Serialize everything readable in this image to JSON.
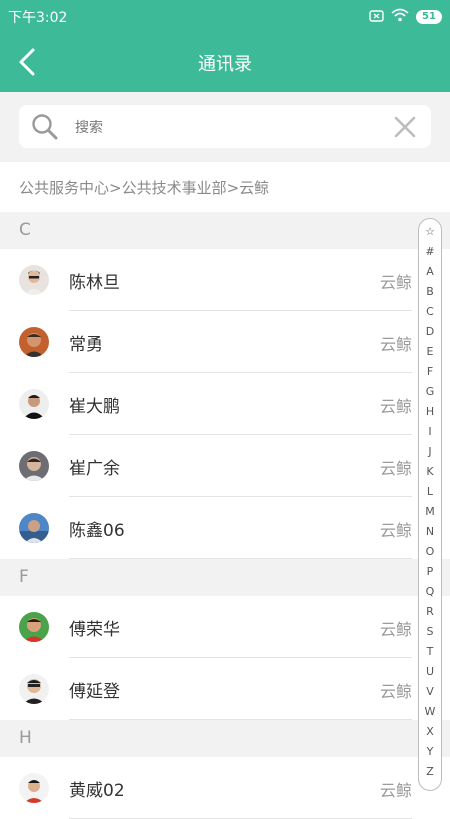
{
  "status_bar": {
    "time": "下午3:02",
    "battery": "51"
  },
  "nav": {
    "title": "通讯录"
  },
  "search": {
    "placeholder": "搜索",
    "value": ""
  },
  "breadcrumb": "公共服务中心>公共技术事业部>云鲸",
  "sections": [
    {
      "letter": "C",
      "contacts": [
        {
          "name": "陈林旦",
          "org": "云鲸"
        },
        {
          "name": "常勇",
          "org": "云鲸"
        },
        {
          "name": "崔大鹏",
          "org": "云鲸"
        },
        {
          "name": "崔广余",
          "org": "云鲸"
        },
        {
          "name": "陈鑫06",
          "org": "云鲸"
        }
      ]
    },
    {
      "letter": "F",
      "contacts": [
        {
          "name": "傅荣华",
          "org": "云鲸"
        },
        {
          "name": "傅延登",
          "org": "云鲸"
        }
      ]
    },
    {
      "letter": "H",
      "contacts": [
        {
          "name": "黄威02",
          "org": "云鲸"
        }
      ]
    }
  ],
  "index": [
    "☆",
    "#",
    "A",
    "B",
    "C",
    "D",
    "E",
    "F",
    "G",
    "H",
    "I",
    "J",
    "K",
    "L",
    "M",
    "N",
    "O",
    "P",
    "Q",
    "R",
    "S",
    "T",
    "U",
    "V",
    "W",
    "X",
    "Y",
    "Z"
  ],
  "colors": {
    "accent": "#3dbb99",
    "background": "#f2f2f2"
  }
}
